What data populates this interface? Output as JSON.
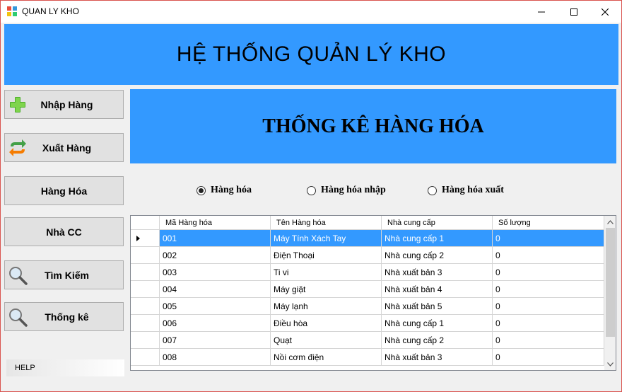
{
  "window": {
    "title": "QUAN LY KHO"
  },
  "header": {
    "title": "HỆ THỐNG QUẢN LÝ KHO"
  },
  "subheader": {
    "title": "THỐNG KÊ HÀNG HÓA"
  },
  "nav": [
    {
      "label": "Nhập Hàng",
      "icon": "plus-icon"
    },
    {
      "label": "Xuất Hàng",
      "icon": "swap-arrows-icon"
    },
    {
      "label": "Hàng Hóa",
      "icon": ""
    },
    {
      "label": "Nhà CC",
      "icon": ""
    },
    {
      "label": "Tìm Kiếm",
      "icon": "magnifier-icon"
    },
    {
      "label": "Thống kê",
      "icon": "magnifier-icon"
    }
  ],
  "help": {
    "label": "HELP"
  },
  "filters": {
    "selected": 0,
    "options": [
      "Hàng hóa",
      "Hàng hóa nhập",
      "Hàng hóa xuất"
    ]
  },
  "table": {
    "columns": [
      "Mã Hàng hóa",
      "Tên Hàng hóa",
      "Nhà cung cấp",
      "Số lượng"
    ],
    "rows": [
      [
        "001",
        "Máy Tính Xách Tay",
        "Nhà cung cấp 1",
        "0"
      ],
      [
        "002",
        "Điện Thoại",
        "Nhà cung cấp 2",
        "0"
      ],
      [
        "003",
        "Ti vi",
        "Nhà xuất bản 3",
        "0"
      ],
      [
        "004",
        "Máy giặt",
        "Nhà xuất bản 4",
        "0"
      ],
      [
        "005",
        "Máy lạnh",
        "Nhà xuất bản 5",
        "0"
      ],
      [
        "006",
        "Điều hòa",
        "Nhà cung cấp 1",
        "0"
      ],
      [
        "007",
        "Quạt",
        "Nhà cung cấp 2",
        "0"
      ],
      [
        "008",
        "Nồi cơm điện",
        "Nhà xuất bản 3",
        "0"
      ]
    ],
    "selected_row": 0
  },
  "colors": {
    "accent": "#3399ff",
    "button_bg": "#e1e1e1",
    "selection": "#3399ff"
  }
}
